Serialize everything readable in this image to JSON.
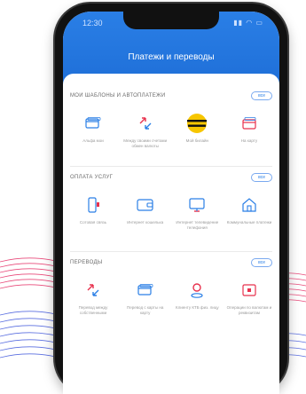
{
  "status": {
    "time": "12:30",
    "icons": "▮▮ ◠ ▭"
  },
  "header": {
    "title": "Платежи и переводы"
  },
  "sections": [
    {
      "title": "МОИ ШАБЛОНЫ И АВТОПЛАТЕЖИ",
      "all_label": "все",
      "items": [
        {
          "label": "Альфа мои"
        },
        {
          "label": "Между своими счетами обмен валюты"
        },
        {
          "label": "Мой билайн"
        },
        {
          "label": "На карту"
        }
      ]
    },
    {
      "title": "ОПЛАТА УСЛУГ",
      "all_label": "все",
      "items": [
        {
          "label": "Сотовая связь"
        },
        {
          "label": "Интернет кошелька"
        },
        {
          "label": "Интернет телевидение телефония"
        },
        {
          "label": "Коммунальные платежи"
        }
      ]
    },
    {
      "title": "ПЕРЕВОДЫ",
      "all_label": "все",
      "items": [
        {
          "label": "Перевод между собственными"
        },
        {
          "label": "Перевод с карты на карту"
        },
        {
          "label": "Клиенту КТБ физ. лицу"
        },
        {
          "label": "Операции по валютам и реквизитам"
        }
      ]
    }
  ],
  "colors": {
    "accent": "#2a7fe6",
    "icon_blue": "#2a7fe6",
    "icon_red": "#e8314d",
    "beeline": "#f7c600"
  }
}
